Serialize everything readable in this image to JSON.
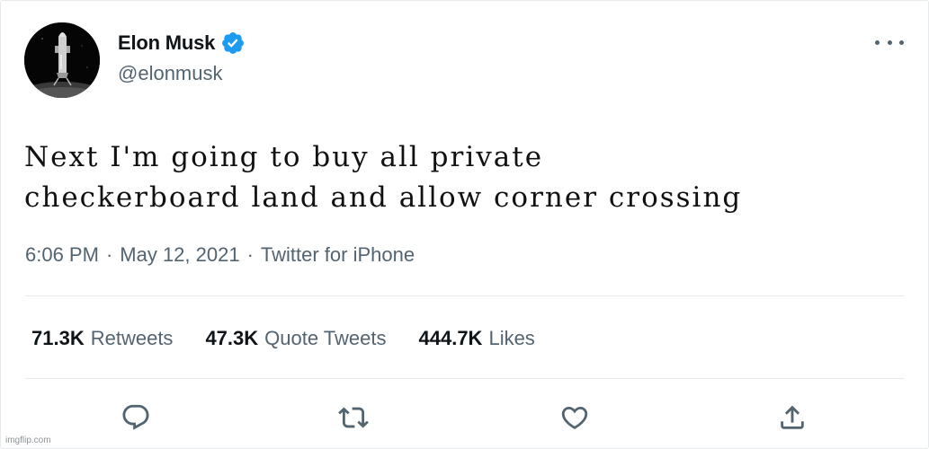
{
  "author": {
    "name": "Elon Musk",
    "handle": "@elonmusk",
    "verified": true
  },
  "tweet": {
    "text": "Next I'm going to buy all private\ncheckerboard land and allow corner crossing",
    "time": "6:06 PM",
    "date": "May 12, 2021",
    "source": "Twitter for iPhone",
    "separator": "·"
  },
  "stats": {
    "retweets": {
      "count": "71.3K",
      "label": "Retweets"
    },
    "quote_tweets": {
      "count": "47.3K",
      "label": "Quote Tweets"
    },
    "likes": {
      "count": "444.7K",
      "label": "Likes"
    }
  },
  "actions": [
    "reply-icon",
    "retweet-icon",
    "like-icon",
    "share-icon"
  ],
  "colors": {
    "text_primary": "#0f1419",
    "text_secondary": "#536471",
    "verified_blue": "#1d9bf0",
    "divider": "#e7e9ea"
  },
  "watermark": "imgflip.com"
}
